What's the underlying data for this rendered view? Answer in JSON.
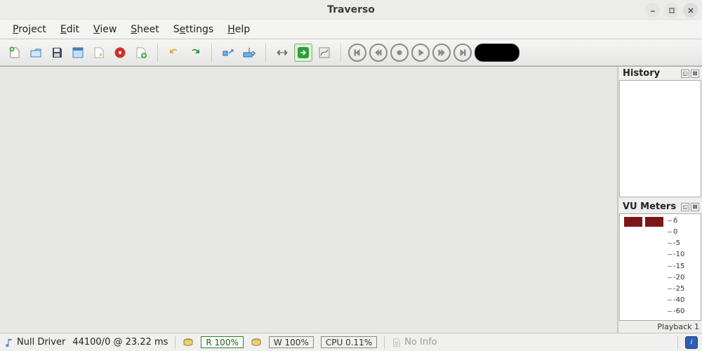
{
  "window": {
    "title": "Traverso"
  },
  "menu": {
    "project": "Project",
    "edit": "Edit",
    "view": "View",
    "sheet": "Sheet",
    "settings": "Settings",
    "help": "Help"
  },
  "panels": {
    "history": {
      "title": "History"
    },
    "vu": {
      "title": "VU Meters",
      "scale": [
        "6",
        "0",
        "-5",
        "-10",
        "-15",
        "-20",
        "-25",
        "-40",
        "-60"
      ],
      "footer": "Playback 1"
    }
  },
  "status": {
    "driver": "Null Driver",
    "rate_latency": "44100/0 @ 23.22 ms",
    "read": "R 100%",
    "write": "W 100%",
    "cpu": "CPU 0.11%",
    "info": "No Info"
  }
}
